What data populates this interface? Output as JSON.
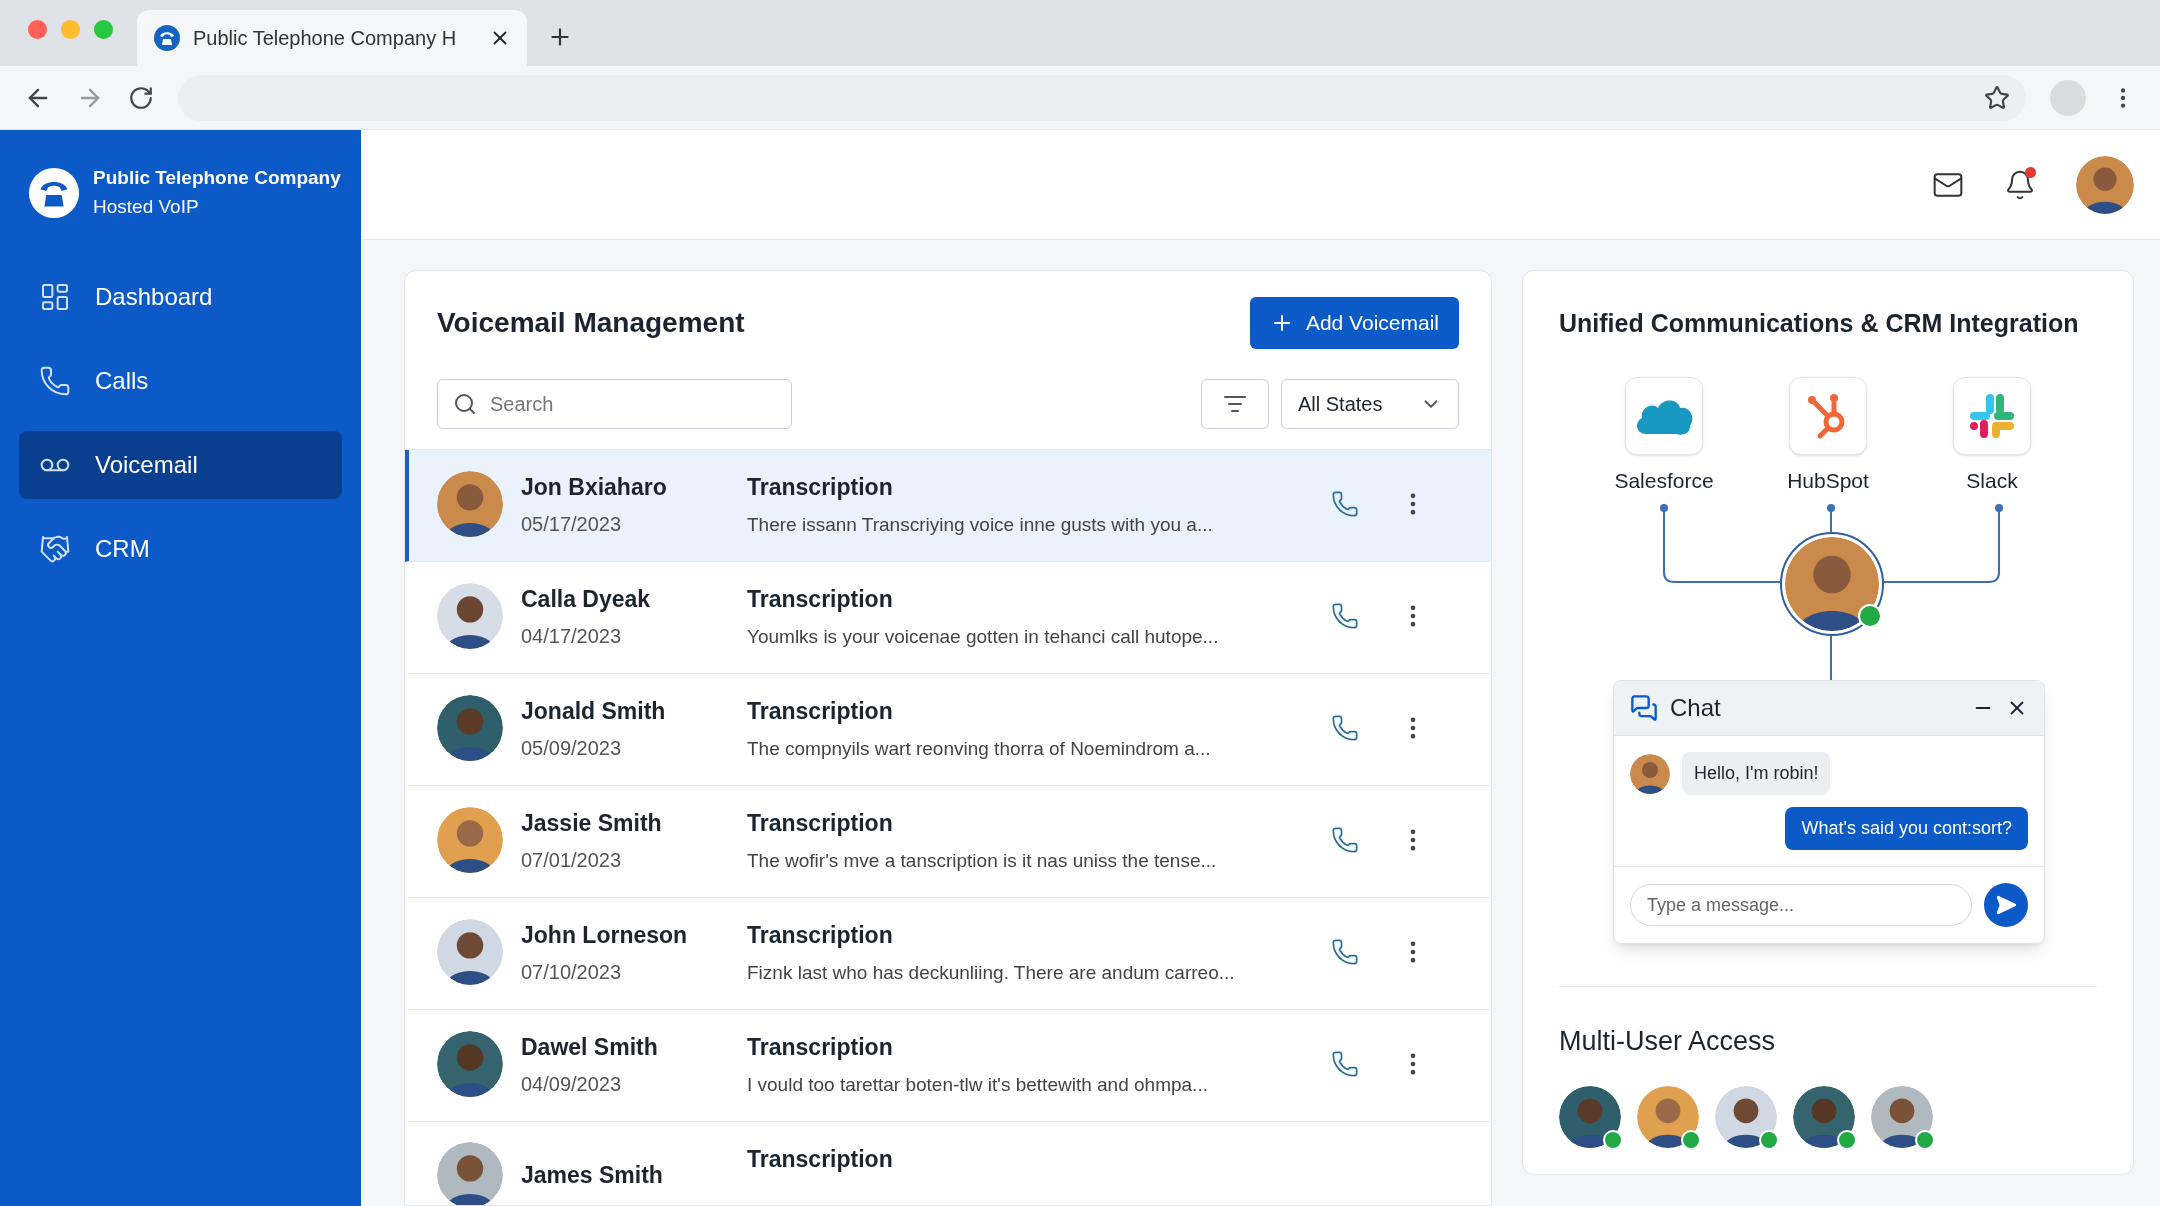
{
  "browser": {
    "tab_title": "Public Telephone Company H"
  },
  "brand": {
    "title": "Public Telephone Company",
    "subtitle": "Hosted VoIP"
  },
  "sidebar": {
    "items": [
      {
        "label": "Dashboard",
        "selected": false
      },
      {
        "label": "Calls",
        "selected": false
      },
      {
        "label": "Voicemail",
        "selected": true
      },
      {
        "label": "CRM",
        "selected": false
      }
    ]
  },
  "header": {
    "unread_notifications": true
  },
  "voicemail": {
    "title": "Voicemail Management",
    "add_button": "Add Voicemail",
    "search": {
      "placeholder": "Search"
    },
    "state_filter": "All States",
    "rows": [
      {
        "name": "Jon Bxiaharo",
        "date": "05/17/2023",
        "label": "Transcription",
        "text": "There issann Transcriying voice inne gusts with you a...",
        "selected": true
      },
      {
        "name": "Calla Dyeak",
        "date": "04/17/2023",
        "label": "Transcription",
        "text": "Youmlks is your voicenae gotten in tehanci call hutope...",
        "selected": false
      },
      {
        "name": "Jonald Smith",
        "date": "05/09/2023",
        "label": "Transcription",
        "text": "The compnyils wart reonving thorra of Noemindrom a...",
        "selected": false
      },
      {
        "name": "Jassie Smith",
        "date": "07/01/2023",
        "label": "Transcription",
        "text": "The wofir's mve a tanscription is it nas uniss the tense...",
        "selected": false
      },
      {
        "name": "John Lorneson",
        "date": "07/10/2023",
        "label": "Transcription",
        "text": "Fiznk last who has deckunliing. There are andum carreo...",
        "selected": false
      },
      {
        "name": "Dawel Smith",
        "date": "04/09/2023",
        "label": "Transcription",
        "text": "I vould too tarettar boten-tlw it's bettewith and ohmpa...",
        "selected": false
      },
      {
        "name": "James Smith",
        "label": "Transcription",
        "selected": false
      }
    ]
  },
  "integration": {
    "title": "Unified Communications & CRM Integration",
    "apps": [
      {
        "name": "Salesforce",
        "kind": "cloud"
      },
      {
        "name": "HubSpot",
        "kind": "sprocket"
      },
      {
        "name": "Slack",
        "kind": "hash"
      }
    ],
    "hub_online": true,
    "chat": {
      "title": "Chat",
      "messages": [
        {
          "kind": "received",
          "text": "Hello, I'm robin!"
        },
        {
          "kind": "sent",
          "text": "What's said you cont:sort?"
        }
      ],
      "placeholder": "Type a message..."
    }
  },
  "multi_user": {
    "title": "Multi-User Access",
    "users": [
      {
        "online": true
      },
      {
        "online": true
      },
      {
        "online": true
      },
      {
        "online": true
      },
      {
        "online": true
      }
    ]
  }
}
